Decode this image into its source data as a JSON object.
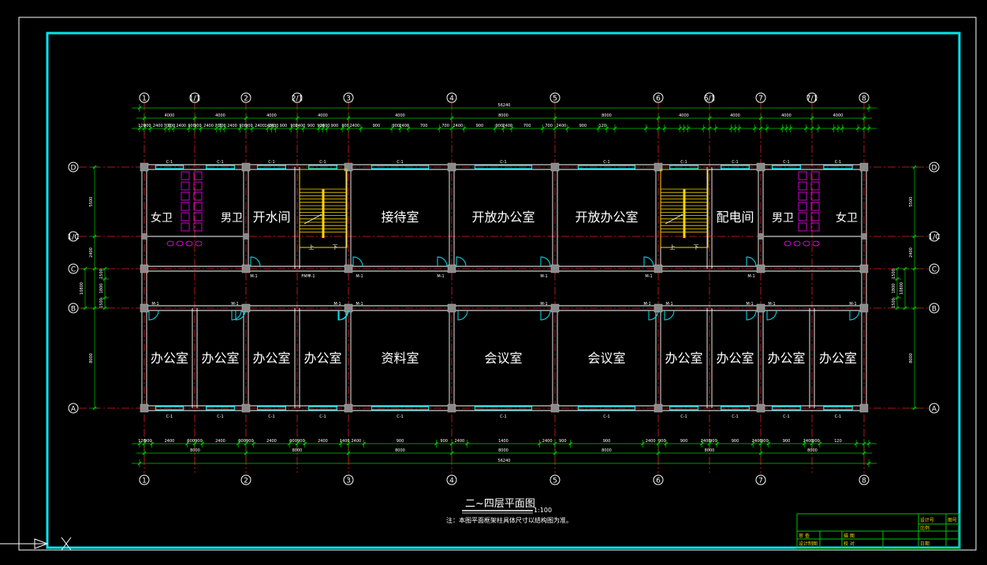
{
  "sheet": {
    "title": "二~四层平面图",
    "scale": "1:100",
    "note": "注：本图平面框架柱具体尺寸以结构图为准。"
  },
  "axes": {
    "columns": [
      "1",
      "1/1",
      "2",
      "2/1",
      "3",
      "4",
      "5",
      "6",
      "6/1",
      "7",
      "7/1",
      "8"
    ],
    "rows": [
      "D",
      "1/C",
      "C",
      "B",
      "A"
    ]
  },
  "dimensions": {
    "overall": "56240",
    "top_middle": [
      "4000",
      "4000",
      "4000",
      "4000",
      "4000",
      "8000",
      "8000",
      "4000",
      "4000",
      "4000",
      "4000"
    ],
    "top_detail": [
      "120",
      "900",
      "2400",
      "700",
      "700",
      "2400",
      "900",
      "900",
      "2400",
      "700",
      "700",
      "2400",
      "900",
      "900",
      "2400",
      "1400",
      "2400",
      "900",
      "900",
      "2400",
      "900",
      "900",
      "2400",
      "900",
      "900",
      "2400",
      "900",
      "900",
      "2400",
      "700",
      "700",
      "2400",
      "900",
      "900",
      "2400",
      "700",
      "700",
      "2400",
      "900",
      "120"
    ],
    "bottom_detail": [
      "120",
      "900",
      "2400",
      "900",
      "900",
      "2400",
      "900",
      "900",
      "2400",
      "900",
      "900",
      "2400",
      "1400",
      "2400",
      "900",
      "900",
      "2400",
      "1400",
      "2400",
      "900",
      "900",
      "2400",
      "900",
      "900",
      "2400",
      "900",
      "900",
      "2400",
      "900",
      "900",
      "2400",
      "900",
      "120"
    ],
    "bottom_middle": [
      "8000",
      "8000",
      "8000",
      "8000",
      "8000",
      "8000",
      "8000"
    ],
    "side_left": [
      "5500",
      "2400",
      "2400",
      "1500",
      "1800",
      "1500",
      "8000",
      "10800"
    ],
    "side_right": [
      "5500",
      "2400",
      "10800",
      "1500",
      "1800",
      "1500",
      "8000"
    ]
  },
  "rooms": {
    "top": [
      "女卫",
      "男卫",
      "开水间",
      "接待室",
      "开放办公室",
      "开放办公室",
      "配电间",
      "男卫",
      "女卫"
    ],
    "bottom": [
      "办公室",
      "办公室",
      "办公室",
      "办公室",
      "资料室",
      "会议室",
      "会议室",
      "办公室",
      "办公室",
      "办公室",
      "办公室"
    ]
  },
  "labels": {
    "window_code": "C-1",
    "door_code": "M-1",
    "stair_up": "上",
    "stair_down": "下",
    "fire_door": "FM甲-1"
  },
  "title_block": {
    "rows": [
      "审 查",
      "设计制图",
      "描 图",
      "校 对",
      "审 核"
    ],
    "right": [
      "设计号",
      "图号",
      "比例",
      "日期"
    ]
  },
  "colors": {
    "frame": "#00e5ee",
    "axis": "#e02020",
    "dim": "#00c800",
    "wall": "#ffffff",
    "text": "#ffffff",
    "sanitary": "#ff00ff",
    "stair": "#ffd700"
  }
}
